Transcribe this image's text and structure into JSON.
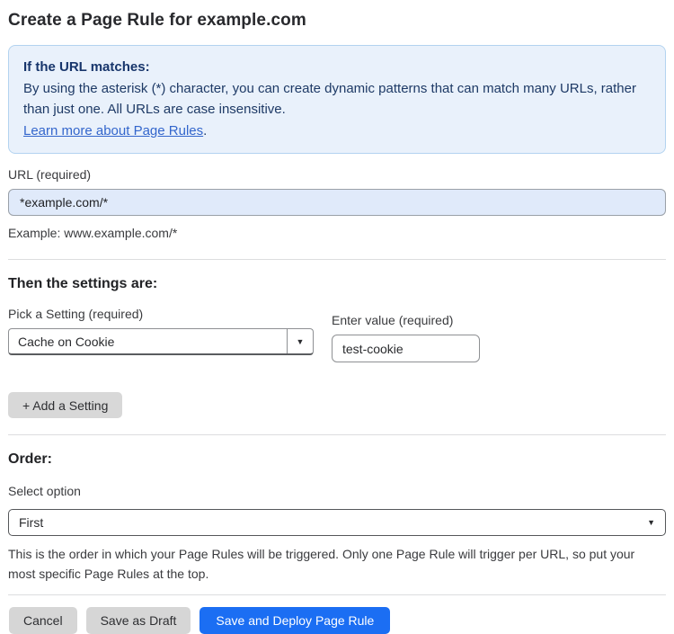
{
  "page": {
    "title": "Create a Page Rule for example.com"
  },
  "info_box": {
    "heading": "If the URL matches:",
    "body": "By using the asterisk (*) character, you can create dynamic patterns that can match many URLs, rather than just one. All URLs are case insensitive.",
    "link": "Learn more about Page Rules",
    "link_suffix": "."
  },
  "url_field": {
    "label": "URL (required)",
    "value": "*example.com/*",
    "helper": "Example: www.example.com/*"
  },
  "settings": {
    "heading": "Then the settings are:",
    "setting_label": "Pick a Setting (required)",
    "setting_value": "Cache on Cookie",
    "value_label": "Enter value (required)",
    "value_value": "test-cookie",
    "add_button_label": "+ Add a Setting"
  },
  "order": {
    "heading": "Order:",
    "label": "Select option",
    "value": "First",
    "helper": "This is the order in which your Page Rules will be triggered. Only one Page Rule will trigger per URL, so put your most specific Page Rules at the top."
  },
  "actions": {
    "cancel_label": "Cancel",
    "save_draft_label": "Save as Draft",
    "save_deploy_label": "Save and Deploy Page Rule"
  },
  "icons": {
    "dropdown_arrow": "▼"
  },
  "colors": {
    "primary_blue": "#1b6ef3",
    "info_bg": "#e9f1fb",
    "info_border": "#b3d3f0",
    "info_text": "#1e3a66",
    "link_blue": "#3366cc",
    "url_input_bg": "#e0eafa",
    "button_gray": "#d6d6d6"
  }
}
